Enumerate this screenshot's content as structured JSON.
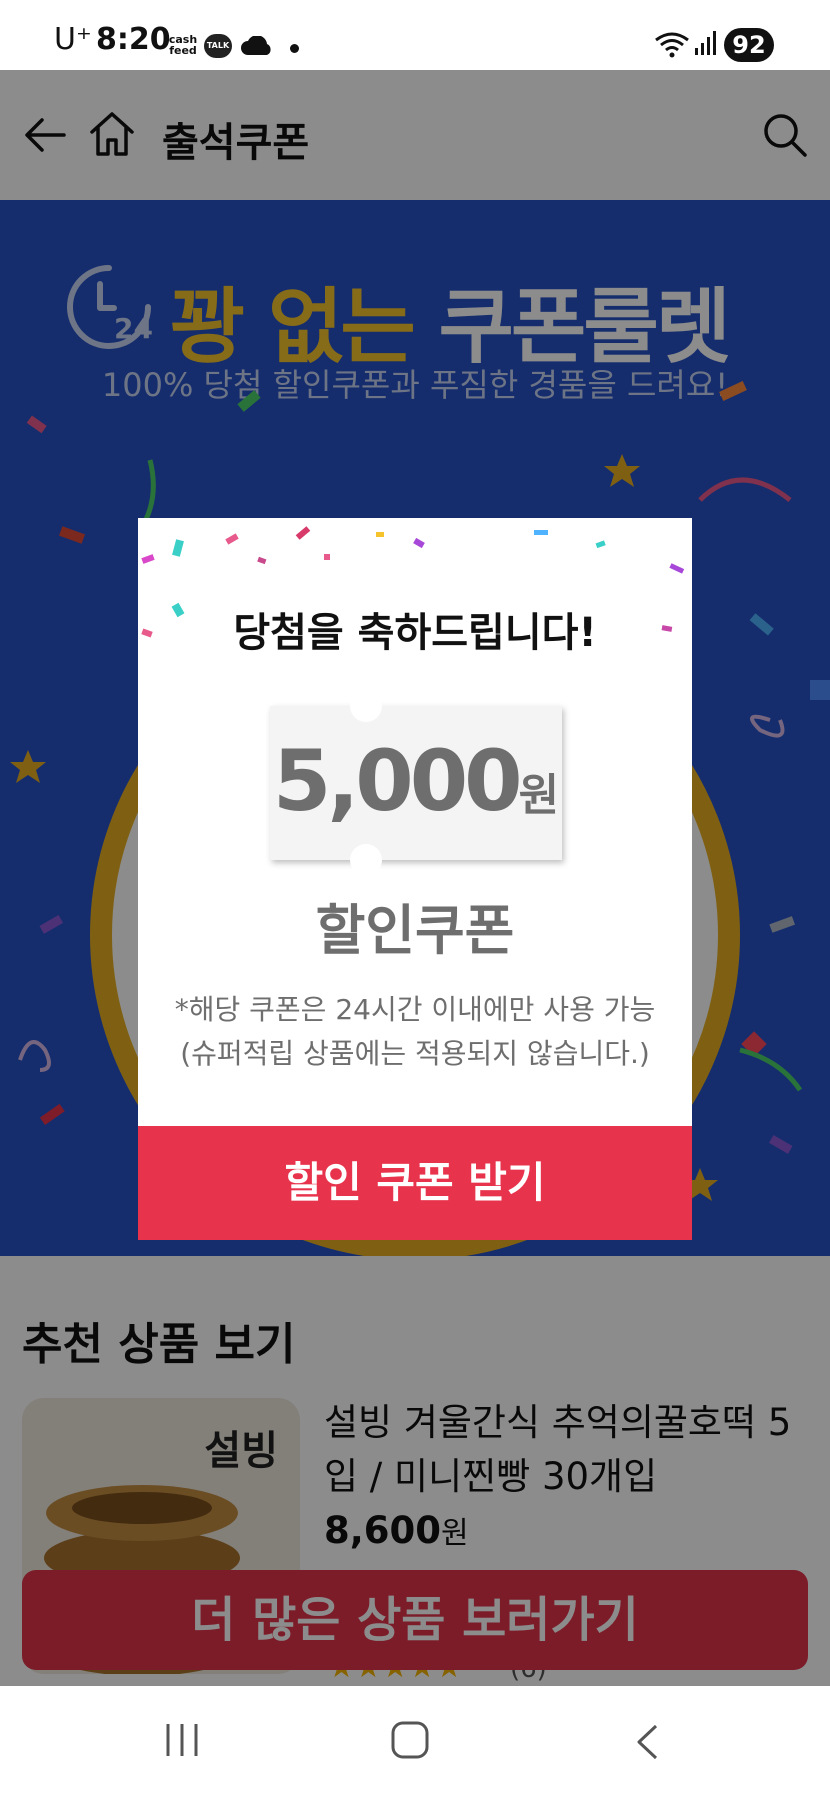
{
  "status_bar": {
    "carrier": "U⁺",
    "time": "8:20",
    "app_badge_cash": "cash feed",
    "app_badge_talk": "TALK",
    "battery": "92"
  },
  "header": {
    "title": "출석쿠폰",
    "back_icon": "arrow-left-icon",
    "home_icon": "home-icon",
    "search_icon": "search-icon"
  },
  "banner": {
    "title_part1": "꽝 없는",
    "title_part2": "쿠폰룰렛",
    "clock_label": "24",
    "subtitle": "100% 당첨 할인쿠폰과 푸짐한 경품을 드려요!"
  },
  "recommend": {
    "title": "추천 상품 보기",
    "product": {
      "brand": "설빙",
      "name": "설빙 겨울간식 추억의꿀호떡 5입 / 미니찐빵 30개입",
      "price": "8,600",
      "price_unit": "원",
      "rating_stars": "★★★★★",
      "review_count": "(6)"
    },
    "more_button": "더 많은 상품 보러가기"
  },
  "modal": {
    "title": "당첨을 축하드립니다!",
    "coupon_amount": "5,000",
    "coupon_currency": "원",
    "coupon_type": "할인쿠폰",
    "notice_line1": "*해당 쿠폰은 24시간 이내에만 사용 가능",
    "notice_line2": "(슈퍼적립 상품에는 적용되지 않습니다.)",
    "claim_button": "할인 쿠폰 받기"
  },
  "colors": {
    "banner_blue": "#2752c7",
    "accent_gold": "#f5c42c",
    "cta_red": "#e8334c"
  }
}
